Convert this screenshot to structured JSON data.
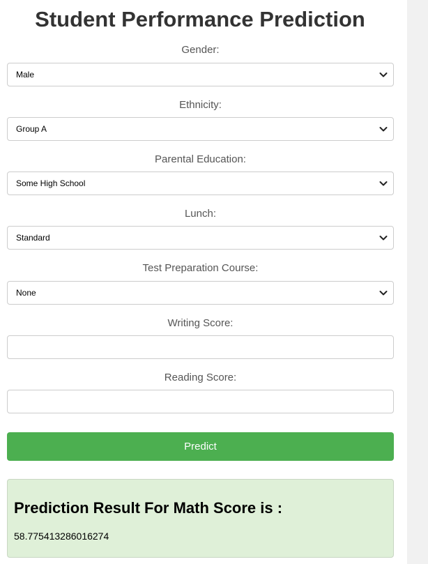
{
  "title": "Student Performance Prediction",
  "form": {
    "gender": {
      "label": "Gender:",
      "value": "Male"
    },
    "ethnicity": {
      "label": "Ethnicity:",
      "value": "Group A"
    },
    "parental_education": {
      "label": "Parental Education:",
      "value": "Some High School"
    },
    "lunch": {
      "label": "Lunch:",
      "value": "Standard"
    },
    "test_prep": {
      "label": "Test Preparation Course:",
      "value": "None"
    },
    "writing_score": {
      "label": "Writing Score:",
      "value": "",
      "placeholder": ""
    },
    "reading_score": {
      "label": "Reading Score:",
      "value": "",
      "placeholder": ""
    },
    "submit_label": "Predict"
  },
  "result": {
    "heading": "Prediction Result For Math Score is :",
    "value": "58.775413286016274"
  },
  "colors": {
    "button": "#4caf50",
    "result_background": "#dff0d8",
    "title": "#333333",
    "label": "#555555"
  },
  "icons": {
    "dropdown": "chevron-down-icon"
  }
}
